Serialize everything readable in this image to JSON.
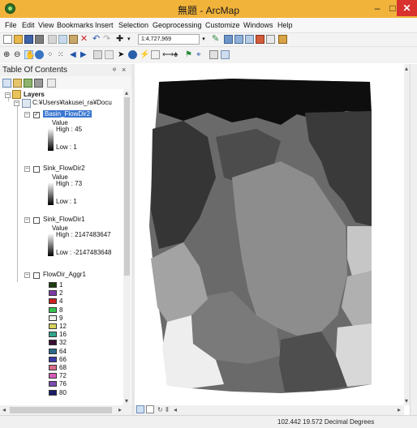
{
  "window": {
    "title": "無題 - ArcMap",
    "minimize": "–",
    "maximize": "□",
    "close": "✕"
  },
  "menu": [
    "File",
    "Edit",
    "View",
    "Bookmarks",
    "Insert",
    "Selection",
    "Geoprocessing",
    "Customize",
    "Windows",
    "Help"
  ],
  "toolbar": {
    "scale_value": "1:4,727,969"
  },
  "toc": {
    "title": "Table Of Contents",
    "pin": "ᵠ",
    "close": "×",
    "layers_label": "Layers",
    "path": "C:¥Users¥takusei_ra¥Docu",
    "layer_items": [
      {
        "name": "Basin_FlowDir2",
        "value_label": "Value",
        "high": "High : 45",
        "low": "Low : 1",
        "checked": true
      },
      {
        "name": "Sink_FlowDir2",
        "value_label": "Value",
        "high": "High : 73",
        "low": "Low : 1",
        "checked": false
      },
      {
        "name": "Sink_FlowDir1",
        "value_label": "Value",
        "high": "High : 2147483647",
        "low": "Low : -2147483648",
        "checked": false
      }
    ],
    "aggr_layer": {
      "name": "FlowDir_Aggr1",
      "classes": [
        {
          "label": "1",
          "color": "#1e3d12"
        },
        {
          "label": "2",
          "color": "#7e3aa8"
        },
        {
          "label": "4",
          "color": "#cc1f1f"
        },
        {
          "label": "8",
          "color": "#33c24d"
        },
        {
          "label": "9",
          "color": "#f3f3ee"
        },
        {
          "label": "12",
          "color": "#d8d25a"
        },
        {
          "label": "16",
          "color": "#2fa58d"
        },
        {
          "label": "32",
          "color": "#3a1030"
        },
        {
          "label": "64",
          "color": "#2a6a8c"
        },
        {
          "label": "66",
          "color": "#3a3aa8"
        },
        {
          "label": "68",
          "color": "#d86d8a"
        },
        {
          "label": "72",
          "color": "#d65ab8"
        },
        {
          "label": "76",
          "color": "#7a4ab0"
        },
        {
          "label": "80",
          "color": "#1c1c6a"
        }
      ]
    }
  },
  "status": {
    "coordinates": "102.442  19.572 Decimal Degrees"
  }
}
